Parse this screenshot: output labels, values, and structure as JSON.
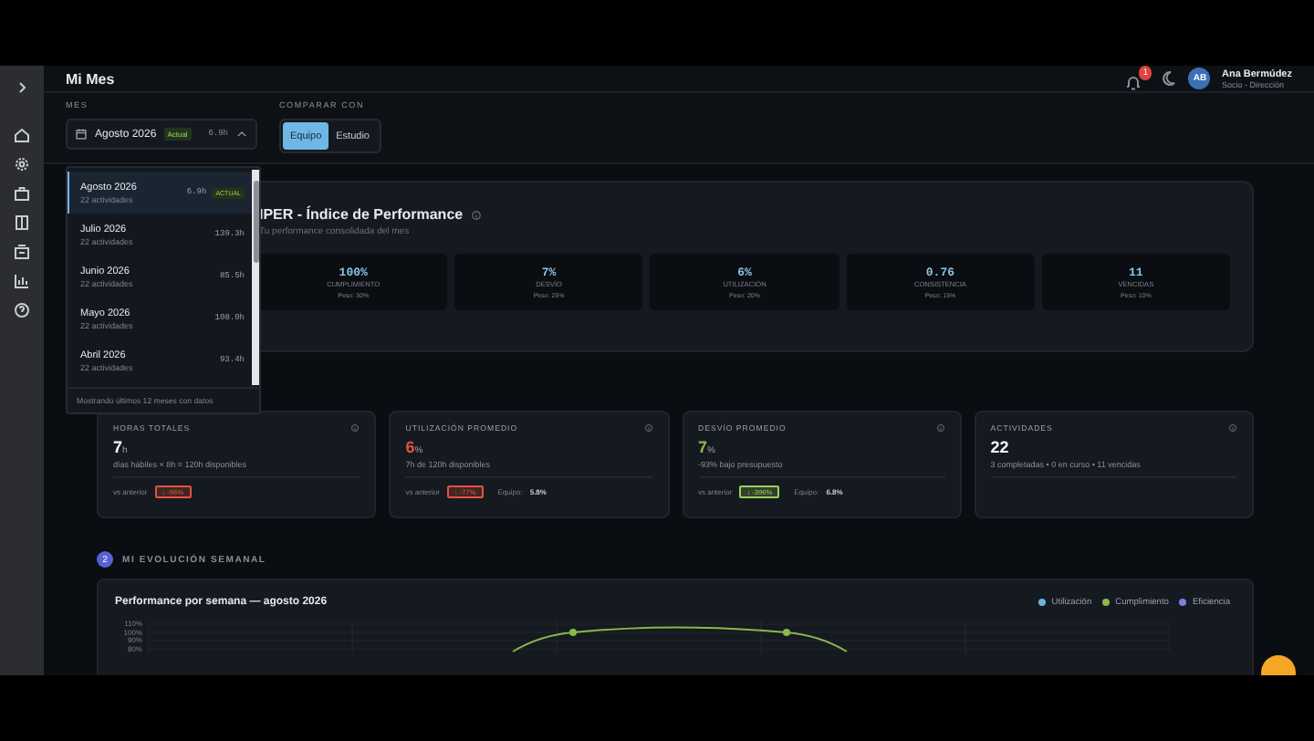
{
  "header": {
    "title": "Mi Mes",
    "notifications": {
      "badge": "1"
    },
    "user": {
      "initials": "AB",
      "name": "Ana Bermúdez",
      "role": "Socio - Dirección"
    }
  },
  "sidebar": {
    "items": [
      {
        "kind": "home"
      },
      {
        "kind": "gear"
      },
      {
        "kind": "briefcase"
      },
      {
        "kind": "book"
      },
      {
        "kind": "building"
      },
      {
        "kind": "chart"
      },
      {
        "kind": "help"
      }
    ]
  },
  "month_picker": {
    "label": "MES",
    "value": "Agosto 2026",
    "badge": "Actual",
    "hours": "6.9h",
    "expanded": true,
    "options": [
      {
        "month": "Agosto 2026",
        "activities": "22 actividades",
        "hours": "6.9h",
        "badge": "ACTUAL",
        "selected": true
      },
      {
        "month": "Julio 2026",
        "activities": "22 actividades",
        "hours": "139.3h",
        "selected": false
      },
      {
        "month": "Junio 2026",
        "activities": "22 actividades",
        "hours": "85.5h",
        "selected": false
      },
      {
        "month": "Mayo 2026",
        "activities": "22 actividades",
        "hours": "108.0h",
        "selected": false
      },
      {
        "month": "Abril 2026",
        "activities": "22 actividades",
        "hours": "93.4h",
        "selected": false
      }
    ],
    "footer": "Mostrando últimos 12 meses con datos"
  },
  "compare": {
    "label": "COMPARAR CON",
    "options": [
      {
        "label": "Equipo",
        "selected": true
      },
      {
        "label": "Estudio",
        "selected": false
      }
    ]
  },
  "iper": {
    "title": "IPER - Índice de Performance",
    "subtitle": "Tu performance consolidada del mes",
    "metrics": [
      {
        "value": "100%",
        "label": "CUMPLIMIENTO",
        "weight": "Peso: 30%"
      },
      {
        "value": "7%",
        "label": "DESVÍO",
        "weight": "Peso: 25%"
      },
      {
        "value": "6%",
        "label": "UTILIZACIÓN",
        "weight": "Peso: 20%"
      },
      {
        "value": "0.76",
        "label": "CONSISTENCIA",
        "weight": "Peso: 15%"
      },
      {
        "value": "11",
        "label": "VENCIDAS",
        "weight": "Peso: 10%"
      }
    ]
  },
  "kpis": [
    {
      "title": "HORAS TOTALES",
      "value": "7",
      "unit": "h",
      "color": "#f2f4f7",
      "detail": "días hábiles × 8h = 120h disponibles",
      "compare_label": "vs anterior",
      "delta": {
        "text": "↓ -96%",
        "color": "#e0533d"
      }
    },
    {
      "title": "UTILIZACIÓN PROMEDIO",
      "value": "6",
      "unit": "%",
      "color": "#e0533d",
      "detail": "7h de 120h disponibles",
      "compare_label": "vs anterior",
      "delta": {
        "text": "↓ -77%",
        "color": "#e0533d"
      },
      "team_label": "Equipo:",
      "team_value": "5.8%"
    },
    {
      "title": "DESVÍO PROMEDIO",
      "value": "7",
      "unit": "%",
      "color": "#8ab84a",
      "detail": "-93% bajo presupuesto",
      "compare_label": "vs anterior",
      "delta": {
        "text": "↓ -396%",
        "color": "#9bcf5a"
      },
      "team_label": "Equipo:",
      "team_value": "6.8%"
    },
    {
      "title": "ACTIVIDADES",
      "value": "22",
      "color": "#f2f4f7",
      "detail": "3 completadas • 0 en curso • 11 vencidas"
    }
  ],
  "section": {
    "number": "2",
    "title": "MI EVOLUCIÓN SEMANAL"
  },
  "weekly_chart": {
    "title": "Performance por semana — agosto 2026",
    "legend": [
      {
        "name": "Utilización",
        "color": "#6fb3e0"
      },
      {
        "name": "Cumplimiento",
        "color": "#8ab84a"
      },
      {
        "name": "Eficiencia",
        "color": "#7b7fe0"
      }
    ],
    "y_axis_labels": [
      "110%",
      "100%",
      "90%",
      "80%"
    ]
  }
}
